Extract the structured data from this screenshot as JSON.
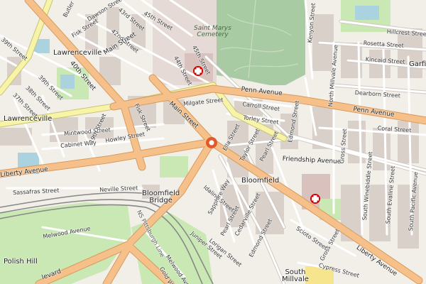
{
  "map": {
    "colors": {
      "background": "#f2efe9",
      "major_road": "#f6c08a",
      "major_casing": "#d99a5b",
      "secondary_road": "#f7f4a8",
      "secondary_casing": "#c8c275",
      "street": "#ffffff",
      "street_casing": "#cfc9c1",
      "building": "#d9d0c9",
      "cemetery": "#a9cba4",
      "park": "#c9e8b4",
      "pool": "#aad3df",
      "railway": "#888888",
      "hospital": "#d40000",
      "marker": "#e05a2b"
    },
    "places": {
      "lawrenceville_n": "Lawrenceville",
      "lawrenceville_w": "Lawrenceville",
      "saint_marys": "Saint Marys\nCemetery",
      "bloomfield": "Bloomfield",
      "bloomfield_bridge": "Bloomfield\nBridge",
      "polish_hill": "Polish Hill",
      "south_millvale": "South\nMillvale",
      "garfield": "Garfie"
    },
    "streets": {
      "butler": "Butler",
      "39th_a": "39th Street",
      "40th": "40th Street",
      "42nd": "42nd Street",
      "43rd": "43rd Street",
      "44th": "44th Street",
      "45th_a": "45th Street",
      "45th_b": "45th Street",
      "dawson": "Dawson Street",
      "fisk_a": "Fisk Street",
      "fisk_b": "Fisk Street",
      "main_a": "Main Street",
      "main_b": "Main Street",
      "39th_b": "39th Street",
      "38th": "38th Street",
      "37th": "37th Street",
      "penn_a": "Penn Avenue",
      "penn_b": "Penn Avenue",
      "carroll": "Carroll Street",
      "torley": "Torley Street",
      "milgate": "Milgate Street",
      "mintwood": "Mintwood Street",
      "cabinet": "Cabinet Way",
      "19th": "19th Street",
      "howley": "Howley Street",
      "liberty_a": "Liberty Avenue",
      "liberty_b": "Liberty Avenue",
      "sassafras": "Sassafras Street",
      "neville": "Neville Street",
      "ella": "Ella Street",
      "taylor": "Taylor Street",
      "pearl_a": "Pearl Street",
      "pearl_b": "Pearl Street",
      "idaline": "Idaline Street",
      "sapphire": "Sapphire Way",
      "juniper": "Juniper Street",
      "lorigan": "Lorigan Street",
      "cedarville": "Cedarville Street",
      "edmond_a": "Edmond Street",
      "edmond_b": "Edmond Street",
      "friendship": "Friendship Avenue",
      "gross_a": "Gross Street",
      "gross_b": "Gross Street",
      "scioto": "Scioto Street",
      "cypress": "Cypress Street",
      "coral": "Coral Street",
      "dearborn": "Dearborn Street",
      "kincaid": "Kincaid Street",
      "rosetta": "Rosetta Street",
      "hillcrest": "Hillcrest Street",
      "north_millvale": "North Millvale Avenue",
      "south_winebiddle": "South Winebiddle Street",
      "south_evaline": "South Evaline Street",
      "south_pacific": "South Pacific Avenue",
      "kenyon": "Kenyon Street",
      "melwood_a": "Melwood Avenue",
      "melwood_b": "Melwood Avenue",
      "ns_pittsburgh": "NS Pittsburgh Line",
      "gold": "Gold Way",
      "boulevard": "levard",
      "lawrenceville_row": "Lawrenceville",
      "40th_b": "40th"
    }
  }
}
